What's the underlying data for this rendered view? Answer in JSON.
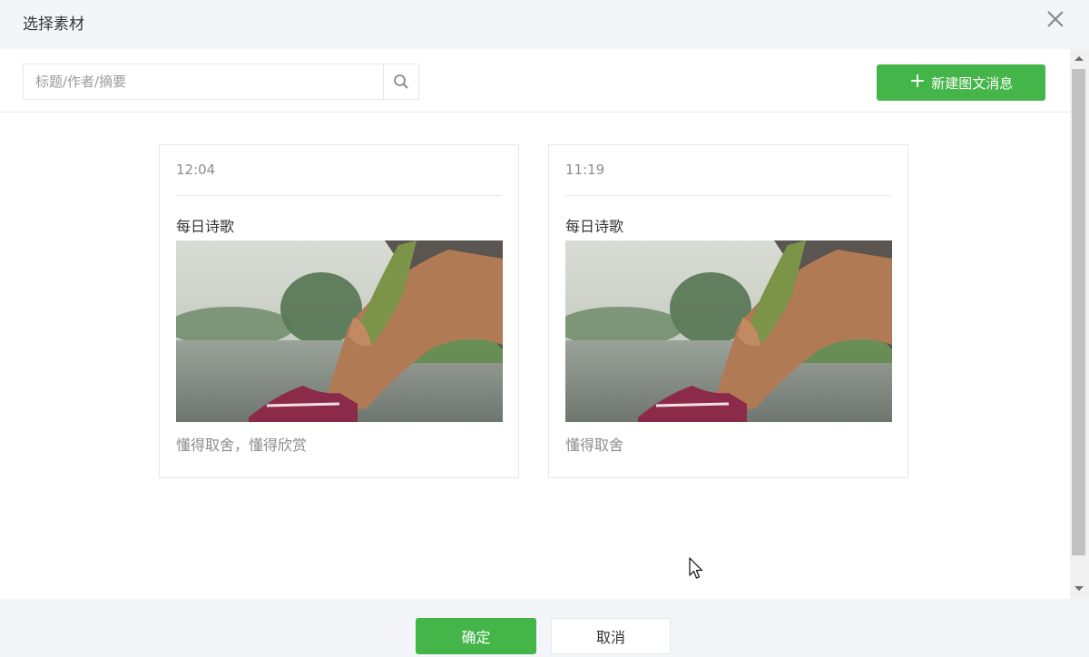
{
  "dialog": {
    "title": "选择素材"
  },
  "search": {
    "placeholder": "标题/作者/摘要",
    "value": ""
  },
  "toolbar": {
    "new_button_label": "新建图文消息"
  },
  "cards": [
    {
      "time": "12:04",
      "title": "每日诗歌",
      "digest": "懂得取舍，懂得欣赏"
    },
    {
      "time": "11:19",
      "title": "每日诗歌",
      "digest": "懂得取舍"
    }
  ],
  "footer": {
    "ok_label": "确定",
    "cancel_label": "取消"
  },
  "colors": {
    "accent": "#44b549",
    "background": "#f4f5f9",
    "border": "#e4e8eb",
    "muted_text": "#8d8d8d"
  },
  "icons": [
    "close-icon",
    "search-icon",
    "plus-icon",
    "mouse-cursor-icon"
  ]
}
